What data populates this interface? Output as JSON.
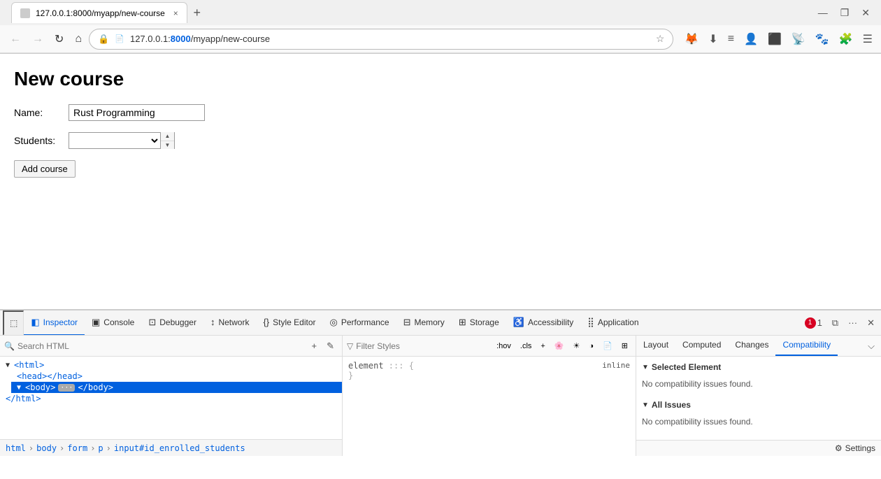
{
  "browser": {
    "tab_title": "127.0.0.1:8000/myapp/new-course",
    "tab_close": "×",
    "tab_new": "+",
    "address": "127.0.0.1:8000/myapp/new-course",
    "address_port": "127.0.0.1:",
    "address_path": "8000/myapp/new-course",
    "nav": {
      "back": "←",
      "forward": "→",
      "reload": "↻",
      "home": "⌂"
    },
    "window_controls": {
      "minimize": "—",
      "restore": "❐",
      "close": "✕"
    }
  },
  "page": {
    "title": "New course",
    "form": {
      "name_label": "Name:",
      "name_value": "Rust Programming",
      "students_label": "Students:",
      "students_value": "",
      "submit_label": "Add course"
    }
  },
  "devtools": {
    "tabs": [
      {
        "id": "inspector",
        "label": "Inspector",
        "icon": "◧",
        "active": true
      },
      {
        "id": "console",
        "label": "Console",
        "icon": "▣"
      },
      {
        "id": "debugger",
        "label": "Debugger",
        "icon": "⊡"
      },
      {
        "id": "network",
        "label": "Network",
        "icon": "↕"
      },
      {
        "id": "style-editor",
        "label": "Style Editor",
        "icon": "{}"
      },
      {
        "id": "performance",
        "label": "Performance",
        "icon": "◎"
      },
      {
        "id": "memory",
        "label": "Memory",
        "icon": "⊟"
      },
      {
        "id": "storage",
        "label": "Storage",
        "icon": "⊞"
      },
      {
        "id": "accessibility",
        "label": "Accessibility",
        "icon": "♿"
      },
      {
        "id": "application",
        "label": "Application",
        "icon": "⣿"
      }
    ],
    "error_count": "1",
    "html_search_placeholder": "Search HTML",
    "html_tree": [
      {
        "id": "html-root",
        "text": "<html>",
        "level": 0,
        "selected": false,
        "expandable": true
      },
      {
        "id": "html-head",
        "text": "<head></head>",
        "level": 1,
        "selected": false
      },
      {
        "id": "html-body",
        "text": "<body>",
        "level": 1,
        "selected": true,
        "has_badge": true,
        "badge": "··· ",
        "close": "</body>"
      },
      {
        "id": "html-close",
        "text": "</html>",
        "level": 0,
        "selected": false
      }
    ],
    "styles": {
      "filter_placeholder": "Filter Styles",
      "pseudo_btns": [
        ":hov",
        ".cls"
      ],
      "toggle_btns": [
        "+",
        "🌸",
        "☀",
        "◑",
        "📄",
        "⊞"
      ],
      "rule": {
        "selector": "element",
        "separator": " ::: ",
        "brace_open": "{",
        "brace_close": "}",
        "inline_label": "inline"
      }
    },
    "compatibility": {
      "tabs": [
        "Layout",
        "Computed",
        "Changes",
        "Compatibility"
      ],
      "active_tab": "Compatibility",
      "sections": [
        {
          "id": "selected-element",
          "title": "Selected Element",
          "expanded": true,
          "message": "No compatibility issues found."
        },
        {
          "id": "all-issues",
          "title": "All Issues",
          "expanded": true,
          "message": "No compatibility issues found."
        }
      ],
      "settings_label": "Settings"
    },
    "breadcrumb": [
      "html",
      "body",
      "form",
      "p",
      "input#id_enrolled_students"
    ]
  }
}
